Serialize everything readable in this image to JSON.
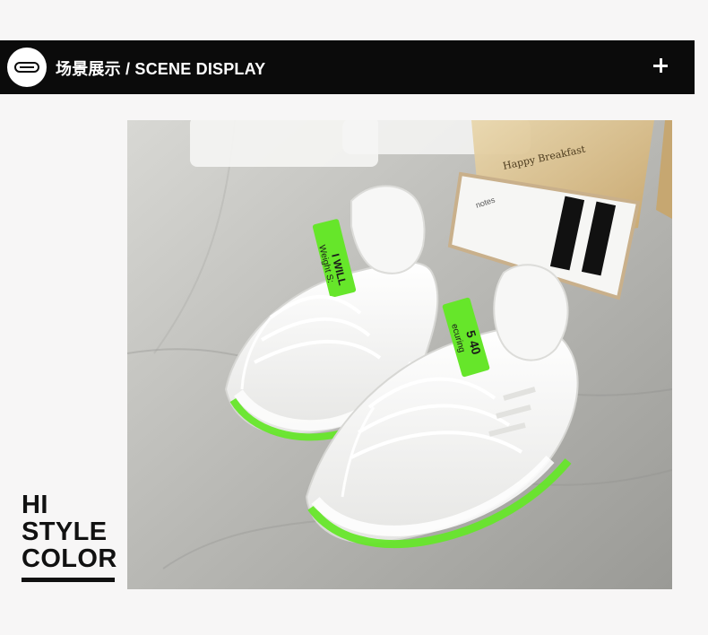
{
  "header": {
    "title": "场景展示 / SCENE DISPLAY",
    "expand_icon": "plus-icon",
    "badge_icon": "pill-badge-icon"
  },
  "side_text": {
    "line1": "HI",
    "line2": "STYLE",
    "line3": "COLOR"
  },
  "photo": {
    "shoe_tag_left": "I WILL",
    "shoe_tag_left_sub": "Weight S:",
    "shoe_tag_right": "5 40",
    "shoe_tag_right_sub": "ecuring",
    "bag_label": "Happy Breakfast",
    "colors": {
      "topbar": "#0b0b0b",
      "accent_green": "#66e62a",
      "shoe_white": "#f2f2f1"
    }
  }
}
